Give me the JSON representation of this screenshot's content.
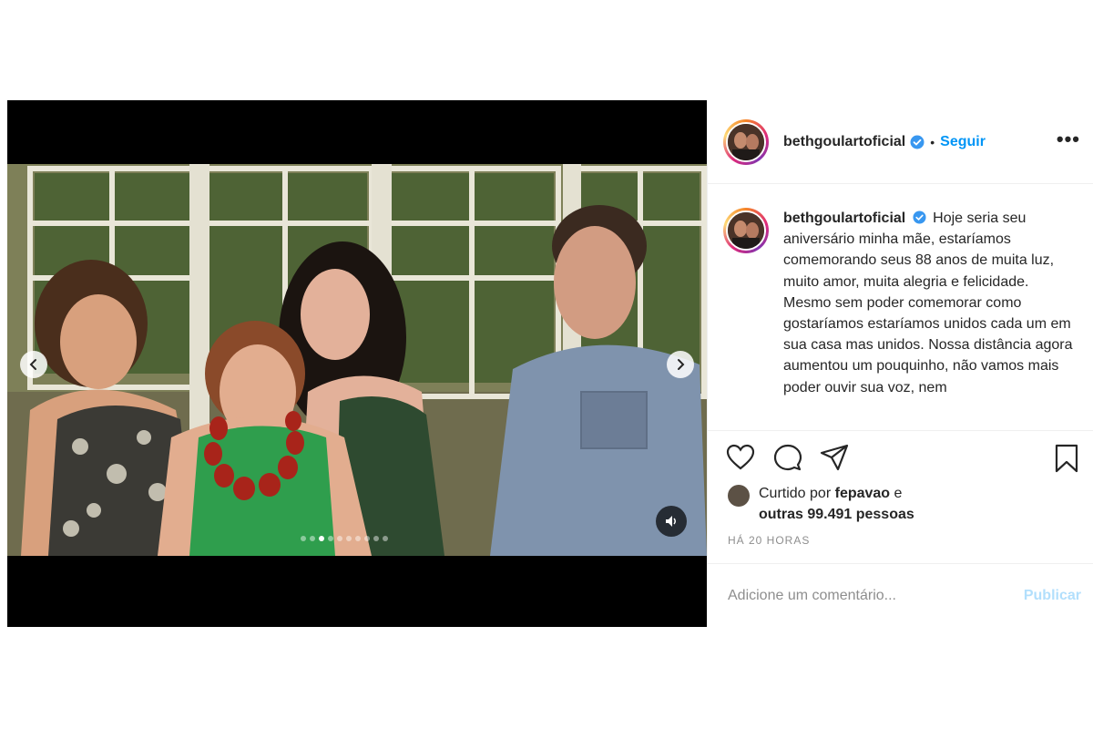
{
  "post": {
    "username": "bethgoulartoficial",
    "separator": "•",
    "follow_label": "Seguir",
    "more_label": "•••",
    "caption": "Hoje seria seu aniversário minha mãe, estaríamos comemorando seus 88 anos de muita luz, muito amor, muita alegria e felicidade. Mesmo sem poder comemorar como gostaríamos estaríamos unidos cada um em sua casa mas unidos. Nossa distância agora aumentou um pouquinho, não vamos mais poder ouvir sua voz, nem",
    "likes": {
      "prefix": "Curtido por",
      "user": "fepavao",
      "conj": "e",
      "others": "outras 99.491 pessoas"
    },
    "time": "HÁ 20 HORAS",
    "comment_placeholder": "Adicione um comentário...",
    "publish_label": "Publicar"
  },
  "carousel": {
    "count": 10,
    "active": 2
  },
  "colors": {
    "accent": "#0095f6",
    "publish_disabled": "#b2dffc",
    "muted": "#8e8e8e"
  },
  "icons": [
    "chevron-left-icon",
    "chevron-right-icon",
    "speaker-icon",
    "heart-icon",
    "comment-icon",
    "share-icon",
    "bookmark-icon",
    "verified-icon"
  ]
}
